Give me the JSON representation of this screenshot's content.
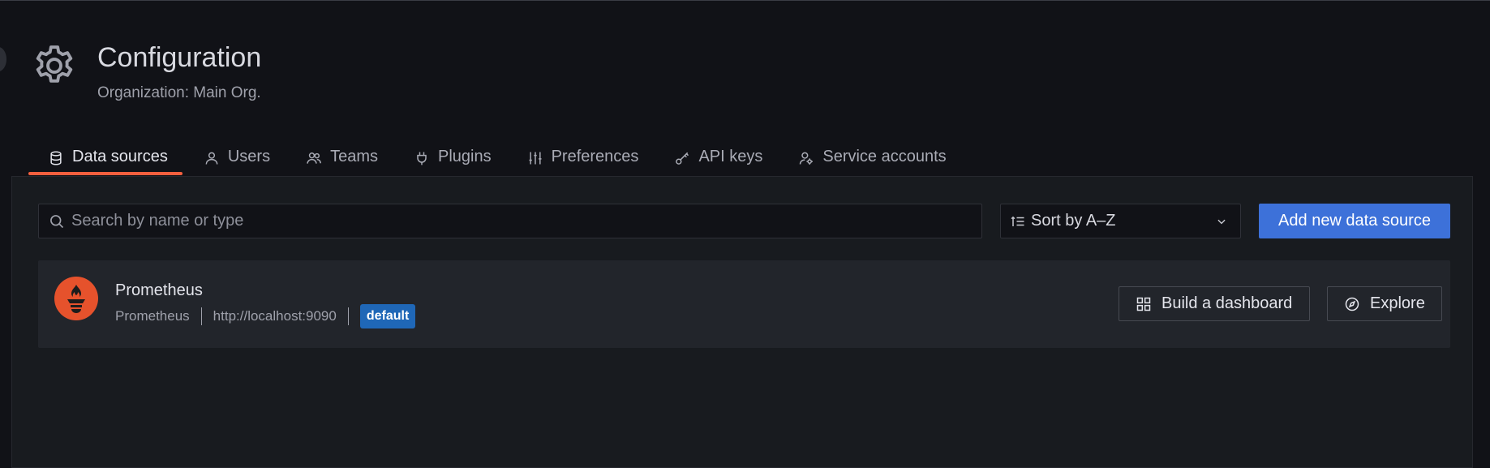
{
  "header": {
    "title": "Configuration",
    "subtitle": "Organization: Main Org.",
    "icon": "gear-icon"
  },
  "tabs": [
    {
      "label": "Data sources",
      "icon": "database-icon",
      "active": true
    },
    {
      "label": "Users",
      "icon": "user-icon",
      "active": false
    },
    {
      "label": "Teams",
      "icon": "users-icon",
      "active": false
    },
    {
      "label": "Plugins",
      "icon": "plug-icon",
      "active": false
    },
    {
      "label": "Preferences",
      "icon": "sliders-icon",
      "active": false
    },
    {
      "label": "API keys",
      "icon": "key-icon",
      "active": false
    },
    {
      "label": "Service accounts",
      "icon": "user-cog-icon",
      "active": false
    }
  ],
  "toolbar": {
    "search_placeholder": "Search by name or type",
    "search_value": "",
    "sort_label": "Sort by A–Z",
    "add_button_label": "Add new data source"
  },
  "datasources": [
    {
      "name": "Prometheus",
      "type": "Prometheus",
      "url": "http://localhost:9090",
      "badge": "default",
      "build_label": "Build a dashboard",
      "explore_label": "Explore"
    }
  ],
  "colors": {
    "background": "#111217",
    "panel": "#181b1f",
    "card": "#22252b",
    "accent_tab": "#f55f3e",
    "primary_button": "#3d71d9",
    "badge": "#1f67b7",
    "prometheus": "#e6522c"
  }
}
